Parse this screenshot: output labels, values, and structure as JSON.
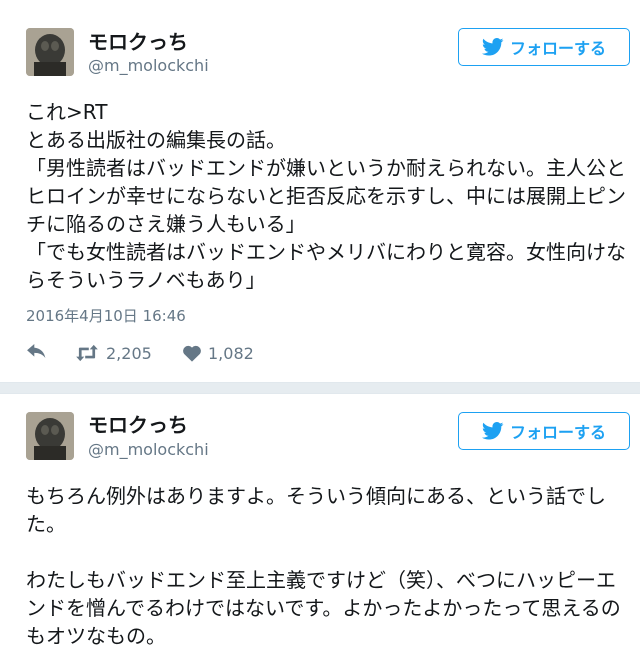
{
  "tweets": [
    {
      "user": {
        "name": "モロクっち",
        "handle": "@m_molockchi"
      },
      "follow_label": "フォローする",
      "text": "これ>RT\nとある出版社の編集長の話。\n「男性読者はバッドエンドが嫌いというか耐えられない。主人公とヒロインが幸せにならないと拒否反応を示すし、中には展開上ピンチに陥るのさえ嫌う人もいる」\n「でも女性読者はバッドエンドやメリバにわりと寛容。女性向けならそういうラノベもあり」",
      "timestamp": "2016年4月10日 16:46",
      "retweets": "2,205",
      "likes": "1,082"
    },
    {
      "user": {
        "name": "モロクっち",
        "handle": "@m_molockchi"
      },
      "follow_label": "フォローする",
      "text": "もちろん例外はありますよ。そういう傾向にある、という話でした。\n\nわたしもバッドエンド至上主義ですけど（笑）、べつにハッピーエンドを憎んでるわけではないです。よかったよかったって思えるのもオツなもの。"
    }
  ],
  "colors": {
    "accent": "#1da1f2",
    "muted": "#657786",
    "background": "#e6ecf0"
  },
  "icons": {
    "follow": "bird-icon",
    "reply": "reply-icon",
    "retweet": "retweet-icon",
    "like": "heart-icon"
  }
}
